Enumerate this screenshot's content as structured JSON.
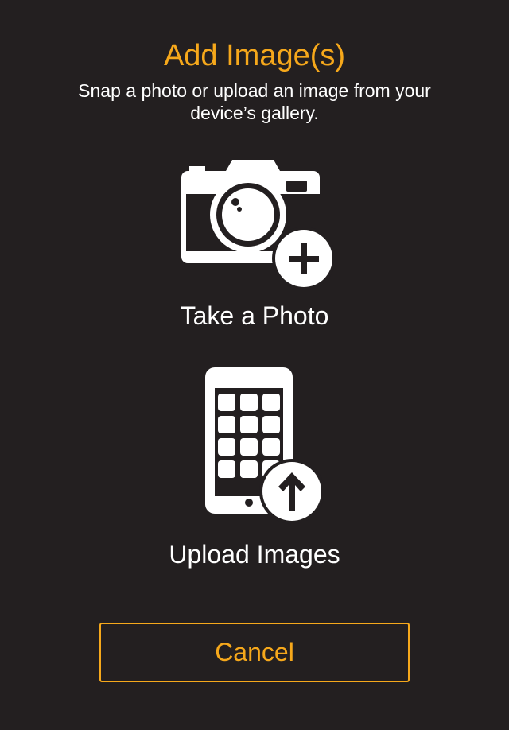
{
  "dialog": {
    "title": "Add Image(s)",
    "subtitle": "Snap a photo or upload an image from your device’s gallery."
  },
  "options": [
    {
      "label": "Take a Photo",
      "icon": "camera-add-icon"
    },
    {
      "label": "Upload Images",
      "icon": "phone-upload-icon"
    }
  ],
  "cancel_label": "Cancel",
  "colors": {
    "background": "#231f20",
    "accent": "#f6a81b",
    "text": "#ffffff"
  }
}
